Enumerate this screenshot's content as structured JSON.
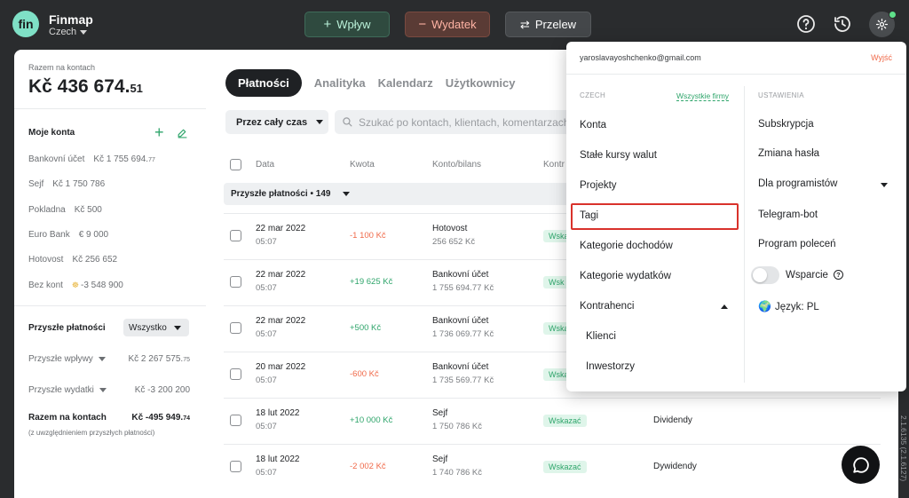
{
  "app": {
    "logo_text": "fin",
    "title": "Finmap",
    "company": "Czech"
  },
  "toolbar": {
    "inflow": "Wpływ",
    "expense": "Wydatek",
    "transfer": "Przelew"
  },
  "sidebar": {
    "total_label": "Razem na kontach",
    "total_main": "Kč 436 674.",
    "total_cents": "51",
    "accounts_title": "Moje konta",
    "accounts": [
      {
        "name": "Bankovní účet",
        "amount": "Kč 1 755 694.",
        "cents": "77"
      },
      {
        "name": "Sejf",
        "amount": "Kč 1 750 786",
        "cents": ""
      },
      {
        "name": "Pokladna",
        "amount": "Kč 500",
        "cents": ""
      },
      {
        "name": "Euro Bank",
        "amount": "€ 9 000",
        "cents": ""
      },
      {
        "name": "Hotovost",
        "amount": "Kč 256 652",
        "cents": ""
      },
      {
        "name": "Bez kont",
        "amount": "-3 548 900",
        "cents": ""
      }
    ],
    "future_title": "Przyszłe płatności",
    "future_filter": "Wszystko",
    "future_in_label": "Przyszłe wpływy",
    "future_in_amount": "Kč 2 267 575.",
    "future_in_cents": "75",
    "future_out_label": "Przyszłe wydatki",
    "future_out_amount": "Kč -3 200 200",
    "projected_label": "Razem na kontach",
    "projected_amount": "Kč -495 949.",
    "projected_cents": "74",
    "projected_note": "(z uwzględnieniem przyszłych płatności)"
  },
  "main": {
    "tabs": [
      "Płatności",
      "Analityka",
      "Kalendarz",
      "Użytkownicy"
    ],
    "period": "Przez cały czas",
    "search_placeholder": "Szukać po kontach, klientach, komentarzach",
    "columns": {
      "date": "Data",
      "amount": "Kwota",
      "account": "Konto/bilans",
      "counterparty": "Kontr"
    },
    "future_group": "Przyszłe płatności • 149",
    "rows": [
      {
        "date": "22 mar 2022",
        "time": "05:07",
        "amount": "-1 100 Kč",
        "type": "neg",
        "account": "Hotovost",
        "balance": "256 652 Kč",
        "tag": "Wskaz",
        "desc": ""
      },
      {
        "date": "22 mar 2022",
        "time": "05:07",
        "amount": "+19 625 Kč",
        "type": "pos",
        "account": "Bankovní účet",
        "balance": "1 755 694.77 Kč",
        "tag": "Wsk",
        "desc": ""
      },
      {
        "date": "22 mar 2022",
        "time": "05:07",
        "amount": "+500 Kč",
        "type": "pos",
        "account": "Bankovní účet",
        "balance": "1 736 069.77 Kč",
        "tag": "Wska",
        "desc": ""
      },
      {
        "date": "20 mar 2022",
        "time": "05:07",
        "amount": "-600 Kč",
        "type": "neg",
        "account": "Bankovní účet",
        "balance": "1 735 569.77 Kč",
        "tag": "Wska",
        "desc": ""
      },
      {
        "date": "18 lut 2022",
        "time": "05:07",
        "amount": "+10 000 Kč",
        "type": "pos",
        "account": "Sejf",
        "balance": "1 750 786 Kč",
        "tag": "Wskazać",
        "desc": "Dividendy"
      },
      {
        "date": "18 lut 2022",
        "time": "05:07",
        "amount": "-2 002 Kč",
        "type": "neg",
        "account": "Sejf",
        "balance": "1 740 786 Kč",
        "tag": "Wskazać",
        "desc": "Dywidendy"
      }
    ]
  },
  "dropdown": {
    "email": "yaroslavayoshchenko@gmail.com",
    "logout": "Wyjść",
    "left_head": "CZECH",
    "all_firms": "Wszystkie firmy",
    "left_items": [
      "Konta",
      "Stałe kursy walut",
      "Projekty",
      "Tagi",
      "Kategorie dochodów",
      "Kategorie wydatków",
      "Kontrahenci",
      "Klienci",
      "Inwestorzy"
    ],
    "right_head": "USTAWIENIA",
    "right_items": [
      "Subskrypcja",
      "Zmiana hasła",
      "Dla programistów",
      "Telegram-bot",
      "Program poleceń"
    ],
    "support": "Wsparcie",
    "language": "Język: PL",
    "highlighted": "Tagi"
  },
  "version": "2.1.6135 (2.1.6127)",
  "colors": {
    "accent_green": "#2fa56b",
    "negative": "#f06a4a",
    "highlight": "#d9322b",
    "topbar": "#2a2c2e"
  },
  "icons": [
    "plus-icon",
    "minus-icon",
    "transfer-icon",
    "help-icon",
    "history-icon",
    "gear-icon",
    "search-icon",
    "chat-icon",
    "globe-icon",
    "edit-icon"
  ]
}
